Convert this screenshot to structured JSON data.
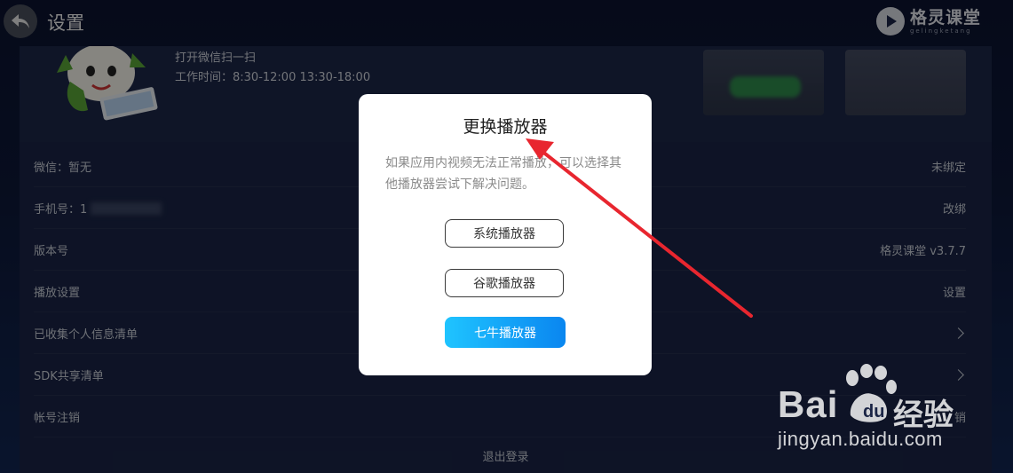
{
  "header": {
    "title": "设置",
    "brand_name": "格灵课堂",
    "brand_sub": "gelingketang"
  },
  "profile": {
    "qr_hint": "打开微信扫一扫",
    "work_hours": "工作时间：8:30-12:00 13:30-18:00"
  },
  "settings": {
    "rows": [
      {
        "label": "微信：暂无",
        "value": "未绑定"
      },
      {
        "label": "手机号：1",
        "value": "改绑"
      },
      {
        "label": "版本号",
        "value": "格灵课堂   v3.7.7"
      },
      {
        "label": "播放设置",
        "value": "设置"
      },
      {
        "label": "已收集个人信息清单",
        "value": ""
      },
      {
        "label": "SDK共享清单",
        "value": ""
      },
      {
        "label": "帐号注销",
        "value": "销"
      }
    ],
    "logout_label": "退出登录"
  },
  "dialog": {
    "title": "更换播放器",
    "description": "如果应用内视频无法正常播放，可以选择其他播放器尝试下解决问题。",
    "options": [
      "系统播放器",
      "谷歌播放器",
      "七牛播放器"
    ]
  },
  "watermark": {
    "brand_left": "Bai",
    "brand_right": "经验",
    "url": "jingyan.baidu.com"
  },
  "colors": {
    "accent": "#0a86f0",
    "annotation_arrow": "#e8262f"
  }
}
